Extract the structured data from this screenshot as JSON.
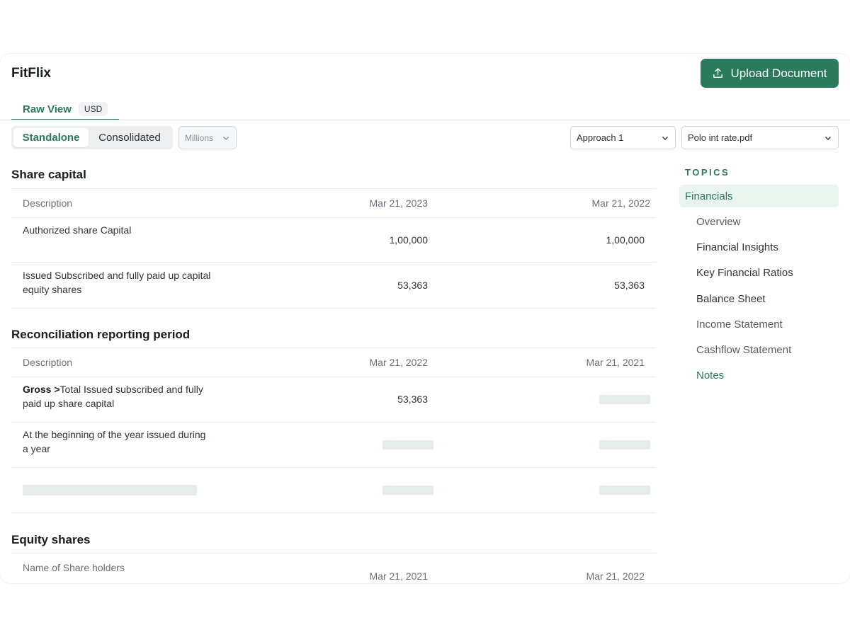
{
  "app": {
    "title": "FitFlix"
  },
  "header": {
    "upload_label": "Upload Document"
  },
  "tabs": {
    "raw_view": "Raw View",
    "currency": "USD"
  },
  "toolbar": {
    "standalone": "Standalone",
    "consolidated": "Consolidated",
    "units": "Millions",
    "approach": "Approach 1",
    "file": "Polo int rate.pdf"
  },
  "share_capital": {
    "title": "Share capital",
    "columns": [
      "Description",
      "Mar 21, 2023",
      "Mar 21, 2022"
    ],
    "rows": [
      {
        "desc": "Authorized share Capital",
        "v1": "1,00,000",
        "v2": "1,00,000"
      },
      {
        "desc": "Issued Subscribed and fully paid up capital equity shares",
        "v1": "53,363",
        "v2": "53,363"
      }
    ]
  },
  "reconciliation": {
    "title": "Reconciliation reporting period",
    "columns": [
      "Description",
      "Mar 21, 2022",
      "Mar 21, 2021"
    ],
    "rows": [
      {
        "desc_bold": "Gross >",
        "desc": "Total Issued subscribed and fully paid up share capital",
        "v1": "53,363"
      },
      {
        "desc": "At the beginning of the year issued during a year"
      }
    ]
  },
  "equity_shares": {
    "title": "Equity shares",
    "columns": [
      "Name of Share holders",
      "Mar 21, 2021",
      "Mar 21, 2022"
    ]
  },
  "topics": {
    "label": "TOPICS",
    "active": "Financials",
    "items": [
      "Overview",
      "Financial Insights",
      "Key Financial Ratios",
      "Balance Sheet",
      "Income Statement",
      "Cashflow Statement",
      "Notes"
    ]
  },
  "colors": {
    "accent": "#2a7a5b",
    "accent_bg": "#eaf4ef",
    "skeleton": "#e6ebee"
  }
}
